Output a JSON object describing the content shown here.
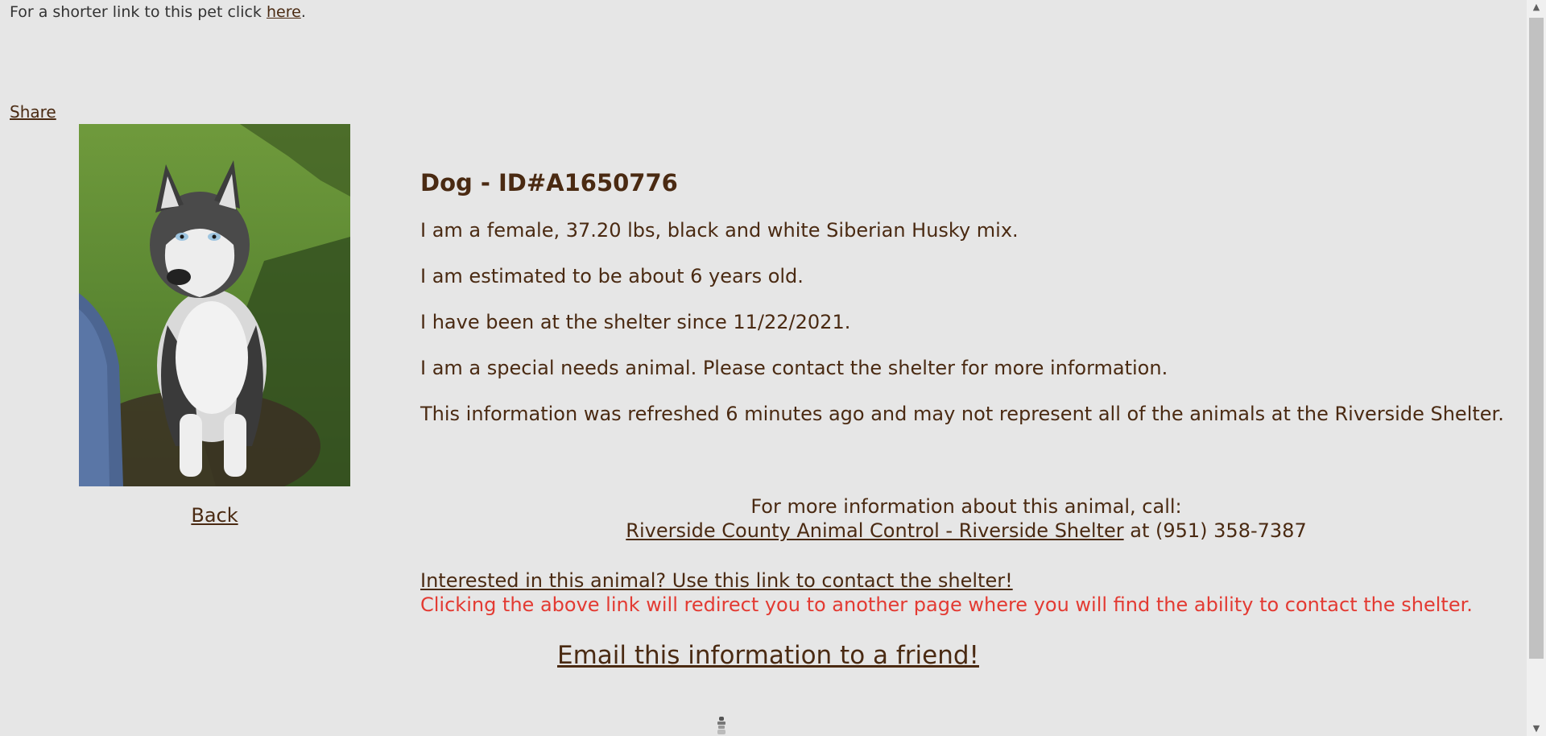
{
  "top_note": {
    "prefix": "For a shorter link to this pet click ",
    "link": "here",
    "suffix": "."
  },
  "share_label": "Share",
  "photo_icon": "husky-dog-photo",
  "back_label": "Back",
  "animal": {
    "title": "Dog - ID#A1650776",
    "description": "I am a female, 37.20 lbs, black and white Siberian Husky mix.",
    "age": "I am estimated to be about 6 years old.",
    "since": "I have been at the shelter since 11/22/2021.",
    "special_needs": "I am a special needs animal. Please contact the shelter for more information.",
    "refreshed": "This information was refreshed 6 minutes ago and may not represent all of the animals at the Riverside Shelter."
  },
  "contact": {
    "call_text": "For more information about this animal, call:",
    "shelter_link": "Riverside County Animal Control - Riverside Shelter",
    "phone_text": " at (951) 358-7387"
  },
  "interested": {
    "link": "Interested in this animal? Use this link to contact the shelter!",
    "warning": "Clicking the above link will redirect you to another page where you will find the ability to contact the shelter."
  },
  "email_label": "Email this information to a friend!",
  "colors": {
    "background": "#e6e6e6",
    "text": "#4a2a12",
    "warning": "#e33a32"
  }
}
